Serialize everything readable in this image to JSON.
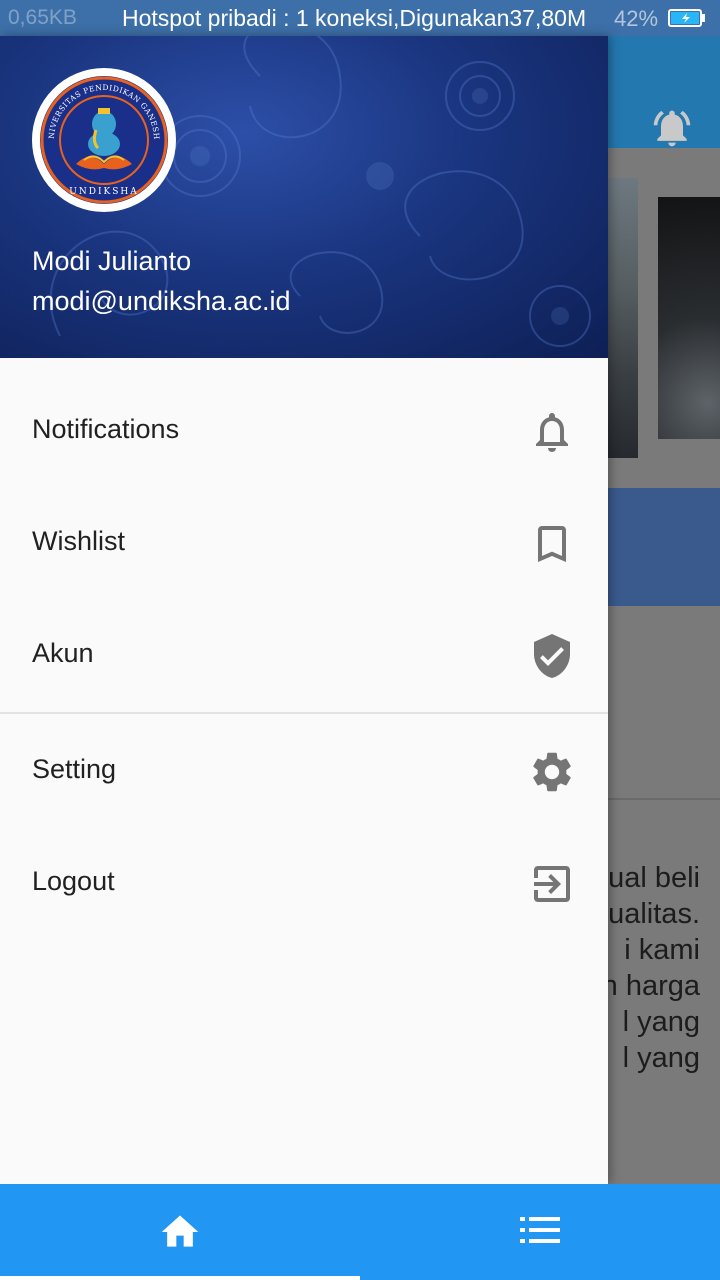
{
  "status_bar": {
    "network_speed": "0,65KB",
    "hotspot_text": "Hotspot pribadi : 1 koneksi,Digunakan37,80M",
    "battery_percent": "42%"
  },
  "drawer": {
    "logo": {
      "top_text": "UNIVERSITAS PENDIDIKAN GANESHA",
      "bottom_text": "UNDIKSHA"
    },
    "user": {
      "name": "Modi Julianto",
      "email": "modi@undiksha.ac.id"
    },
    "menu_items": [
      {
        "label": "Notifications",
        "icon": "bell-outline-icon"
      },
      {
        "label": "Wishlist",
        "icon": "bookmark-outline-icon"
      },
      {
        "label": "Akun",
        "icon": "verified-shield-icon"
      },
      {
        "label": "Setting",
        "icon": "gear-icon"
      },
      {
        "label": "Logout",
        "icon": "logout-icon"
      }
    ]
  },
  "background_content": {
    "paragraph_fragments": [
      "ual beli",
      "ualitas.",
      "i  kami",
      "n harga",
      "l  yang",
      "l  yang"
    ]
  },
  "bottom_nav": {
    "items": [
      {
        "icon": "home-icon",
        "active": true
      },
      {
        "icon": "list-icon",
        "active": false
      }
    ]
  },
  "colors": {
    "primary": "#2196f3",
    "appbar": "#2378b0",
    "icon_grey": "#757575"
  }
}
